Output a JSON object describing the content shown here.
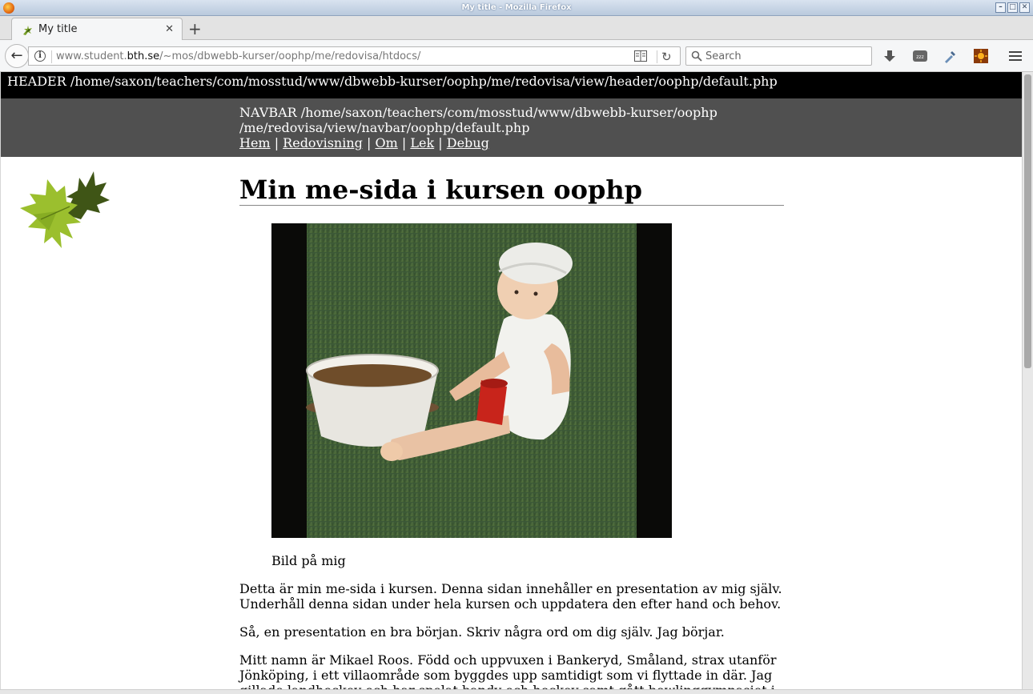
{
  "window": {
    "title": "My title - Mozilla Firefox"
  },
  "tab": {
    "label": "My title"
  },
  "urlbar": {
    "prefix": "www.student.",
    "domain": "bth.se",
    "path": "/~mos/dbwebb-kurser/oophp/me/redovisa/htdocs/"
  },
  "search": {
    "placeholder": "Search"
  },
  "page": {
    "header": "HEADER /home/saxon/teachers/com/mosstud/www/dbwebb-kurser/oophp/me/redovisa/view/header/oophp/default.php",
    "navbar_path_line1": "NAVBAR /home/saxon/teachers/com/mosstud/www/dbwebb-kurser/oophp",
    "navbar_path_line2": "/me/redovisa/view/navbar/oophp/default.php",
    "nav_links": [
      "Hem",
      "Redovisning",
      "Om",
      "Lek",
      "Debug"
    ],
    "nav_separator": "|",
    "heading": "Min me-sida i kursen oophp",
    "caption": "Bild på mig",
    "paragraphs": [
      "Detta är min me-sida i kursen. Denna sidan innehåller en presentation av mig själv. Underhåll denna sidan under hela kursen och uppdatera den efter hand och behov.",
      "Så, en presentation en bra början. Skriv några ord om dig själv. Jag börjar.",
      "Mitt namn är Mikael Roos. Född och uppvuxen i Bankeryd, Småland, strax utanför Jönköping, i ett villaområde som byggdes upp samtidigt som vi flyttade in där. Jag gillade landhockey och har spelat bandy och hockey samt gått bowlinggymnasiet i"
    ]
  },
  "colors": {
    "header_bg": "#000000",
    "navbar_bg": "#505050",
    "titlebar": "#c8d5e6"
  }
}
